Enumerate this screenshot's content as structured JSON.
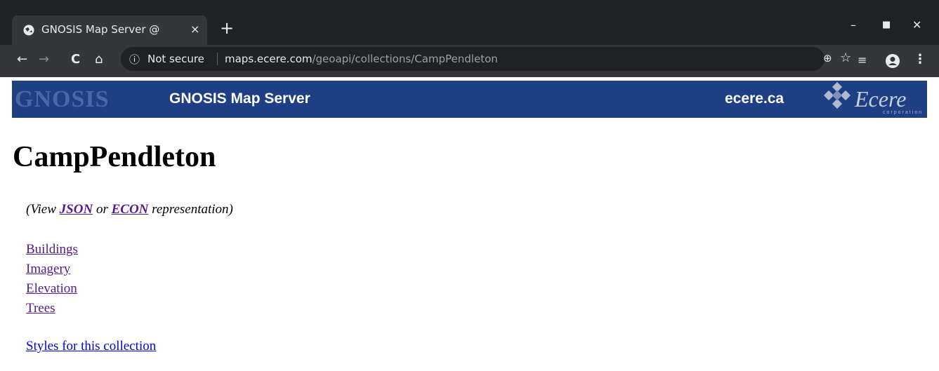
{
  "browser": {
    "tab_title": "GNOSIS Map Server @",
    "tab_close": "×",
    "new_tab": "+",
    "window_controls": {
      "minimize": "–",
      "maximize": "■",
      "close": "✕"
    },
    "nav": {
      "back": "←",
      "forward": "→",
      "reload": "C",
      "home": "⌂"
    },
    "address": {
      "security_label": "Not secure",
      "host": "maps.ecere.com",
      "path": "/geoapi/collections/CampPendleton"
    },
    "toolbar_icons": [
      "zoom-icon",
      "star-icon",
      "reading-list-icon",
      "profile-icon",
      "menu-icon"
    ]
  },
  "banner": {
    "logo_text": "GNOSIS",
    "title": "GNOSIS Map Server",
    "site": "ecere.ca",
    "ecere_logo_text": "Ecere",
    "ecere_logo_sub": "corporation",
    "background_color": "#1f3f85"
  },
  "page": {
    "heading": "CampPendleton",
    "repr_prefix": "(View ",
    "repr_json": "JSON",
    "repr_or": " or ",
    "repr_econ": "ECON",
    "repr_suffix": " representation)",
    "layers": [
      "Buildings",
      "Imagery",
      "Elevation",
      "Trees"
    ],
    "styles_link": "Styles for this collection"
  }
}
